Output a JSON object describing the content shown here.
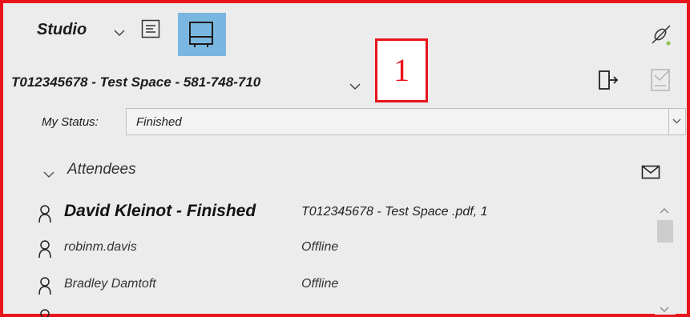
{
  "header": {
    "title": "Studio",
    "callout_number": "1"
  },
  "session": {
    "title": "T012345678 - Test Space - 581-748-710"
  },
  "status": {
    "label": "My Status:",
    "value": "Finished"
  },
  "attendees": {
    "label": "Attendees",
    "list": [
      {
        "name": "David Kleinot - Finished",
        "status": "T012345678 - Test Space .pdf, 1"
      },
      {
        "name": "robinm.davis",
        "status": "Offline"
      },
      {
        "name": "Bradley Damtoft",
        "status": "Offline"
      }
    ]
  },
  "colors": {
    "highlight_border": "#e8141b",
    "active_button": "#7ab7e0",
    "panel_background": "#ececec"
  },
  "icons": [
    "chevron-down-icon",
    "notes-icon",
    "single-display-icon",
    "unlink-icon",
    "exit-session-icon",
    "document-check-icon",
    "mail-icon",
    "person-icon",
    "scroll-up-icon",
    "scroll-down-icon"
  ]
}
